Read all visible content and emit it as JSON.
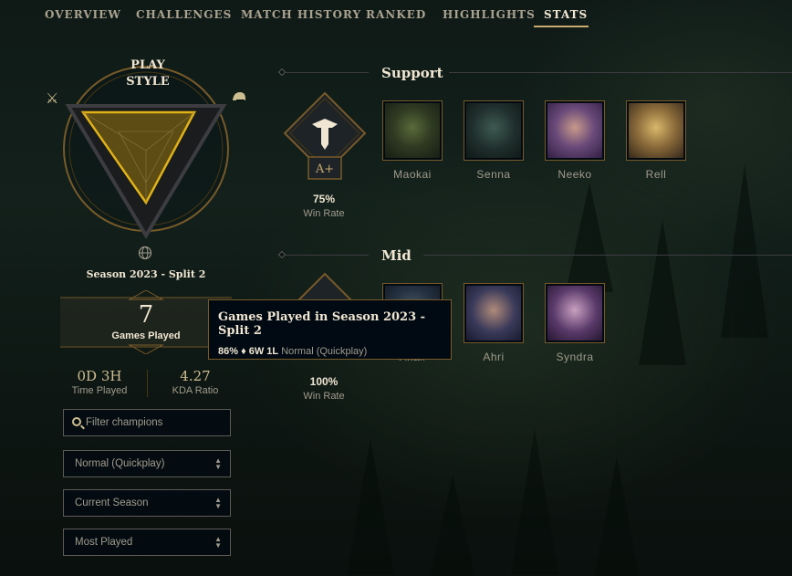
{
  "nav": {
    "tabs": [
      "OVERVIEW",
      "CHALLENGES",
      "MATCH HISTORY",
      "RANKED",
      "HIGHLIGHTS",
      "STATS"
    ],
    "active": "STATS"
  },
  "playstyle": {
    "title_line1": "PLAY",
    "title_line2": "STYLE",
    "left_icon": "crossed-swords-icon",
    "right_icon": "helmet-icon"
  },
  "season": {
    "label": "Season 2023 - Split 2",
    "icon": "globe-icon"
  },
  "games": {
    "count": "7",
    "label": "Games Played"
  },
  "stats": {
    "time_value": "0D 3H",
    "time_label": "Time Played",
    "kda_value": "4.27",
    "kda_label": "KDA Ratio"
  },
  "filters": {
    "search_placeholder": "Filter champions",
    "queue": "Normal (Quickplay)",
    "season": "Current Season",
    "sort": "Most Played"
  },
  "roles": [
    {
      "name": "Support",
      "grade": "A+",
      "win_rate": "75%",
      "win_label": "Win Rate",
      "champions": [
        "Maokai",
        "Senna",
        "Neeko",
        "Rell"
      ]
    },
    {
      "name": "Mid",
      "win_rate": "100%",
      "win_label": "Win Rate",
      "champions": [
        "Akali",
        "Ahri",
        "Syndra"
      ]
    }
  ],
  "tooltip": {
    "title": "Games Played in Season 2023 - Split 2",
    "stats": "86% ♦ 6W 1L",
    "queue": "Normal (Quickplay)"
  },
  "colors": {
    "gold": "#c8aa6e",
    "gold_light": "#f0e6d2",
    "text_muted": "#a09b8c",
    "triangle_fill": "#e0b217"
  }
}
